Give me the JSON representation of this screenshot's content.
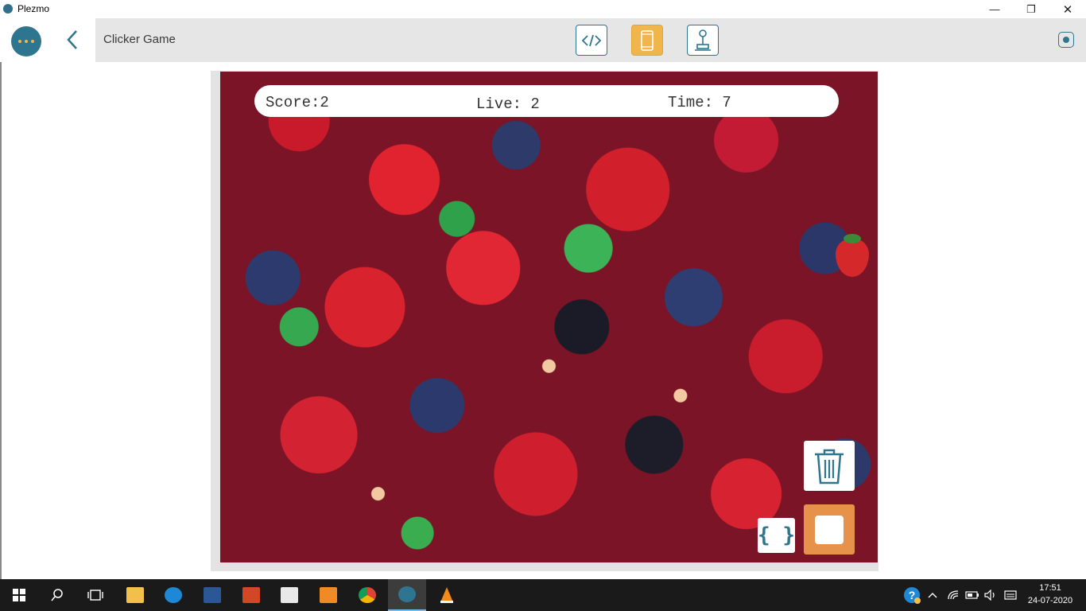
{
  "window": {
    "title": "Plezmo"
  },
  "header": {
    "page_title": "Clicker Game",
    "modes": [
      {
        "name": "code",
        "icon": "code-icon",
        "active": false
      },
      {
        "name": "device",
        "icon": "phone-icon",
        "active": true
      },
      {
        "name": "controller",
        "icon": "joystick-icon",
        "active": false
      }
    ]
  },
  "hud": {
    "score": "Score:2",
    "live": "Live: 2",
    "time": "Time: 7"
  },
  "controls": {
    "braces_label": "{ }"
  },
  "taskbar": {
    "apps": [
      "windows-start",
      "search",
      "task-view",
      "file-explorer",
      "edge",
      "word",
      "powerpoint",
      "store",
      "media-player",
      "chrome",
      "plezmo",
      "vlc"
    ],
    "active_app": "plezmo",
    "clock_time": "17:51",
    "clock_date": "24-07-2020"
  },
  "colors": {
    "accent": "#2e7590",
    "highlight": "#f0b64c",
    "stop": "#e6924a"
  }
}
